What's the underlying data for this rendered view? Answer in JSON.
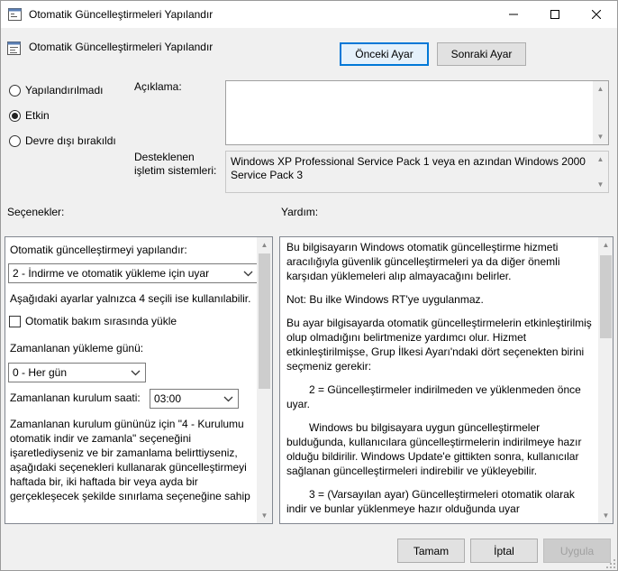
{
  "window": {
    "title": "Otomatik Güncelleştirmeleri Yapılandır"
  },
  "header": {
    "policy_name": "Otomatik Güncelleştirmeleri Yapılandır",
    "prev_button": "Önceki Ayar",
    "next_button": "Sonraki Ayar"
  },
  "state": {
    "options": [
      "Yapılandırılmadı",
      "Etkin",
      "Devre dışı bırakıldı"
    ],
    "selected": "Etkin"
  },
  "comment": {
    "label": "Açıklama:",
    "value": ""
  },
  "supported": {
    "label_line1": "Desteklenen",
    "label_line2": "işletim sistemleri:",
    "value": "Windows XP Professional Service Pack 1 veya en azından Windows 2000 Service Pack 3"
  },
  "options_panel": {
    "heading": "Seçenekler:",
    "configure_label": "Otomatik güncelleştirmeyi yapılandır:",
    "configure_value": "2 - İndirme ve otomatik yükleme için uyar",
    "note": "Aşağıdaki ayarlar yalnızca 4 seçili ise kullanılabilir.",
    "maintenance_checkbox": "Otomatik bakım sırasında yükle",
    "maintenance_checked": false,
    "day_label": "Zamanlanan yükleme günü:",
    "day_value": "0 - Her gün",
    "time_label": "Zamanlanan kurulum saati:",
    "time_value": "03:00",
    "description": "Zamanlanan kurulum gününüz için \"4 - Kurulumu otomatik indir ve zamanla\" seçeneğini işaretlediyseniz ve bir zamanlama belirttiyseniz, aşağıdaki seçenekleri kullanarak güncelleştirmeyi haftada bir, iki haftada bir veya ayda bir gerçekleşecek şekilde sınırlama seçeneğine sahip"
  },
  "help_panel": {
    "heading": "Yardım:",
    "paragraphs": [
      "Bu bilgisayarın Windows otomatik güncelleştirme hizmeti aracılığıyla güvenlik güncelleştirmeleri ya da diğer önemli karşıdan yüklemeleri alıp almayacağını belirler.",
      "Not: Bu ilke Windows RT'ye uygulanmaz.",
      "Bu ayar bilgisayarda otomatik güncelleştirmelerin etkinleştirilmiş olup olmadığını belirtmenize yardımcı olur. Hizmet etkinleştirilmişse, Grup İlkesi Ayarı'ndaki dört seçenekten birini seçmeniz gerekir:",
      "2 = Güncelleştirmeler indirilmeden ve yüklenmeden önce uyar.",
      "Windows bu bilgisayara uygun güncelleştirmeler bulduğunda, kullanıcılara güncelleştirmelerin indirilmeye hazır olduğu bildirilir. Windows Update'e gittikten sonra, kullanıcılar sağlanan güncelleştirmeleri indirebilir ve yükleyebilir.",
      "3 = (Varsayılan ayar) Güncelleştirmeleri otomatik olarak indir ve bunlar yüklenmeye hazır olduğunda uyar"
    ]
  },
  "footer": {
    "ok": "Tamam",
    "cancel": "İptal",
    "apply": "Uygula"
  }
}
